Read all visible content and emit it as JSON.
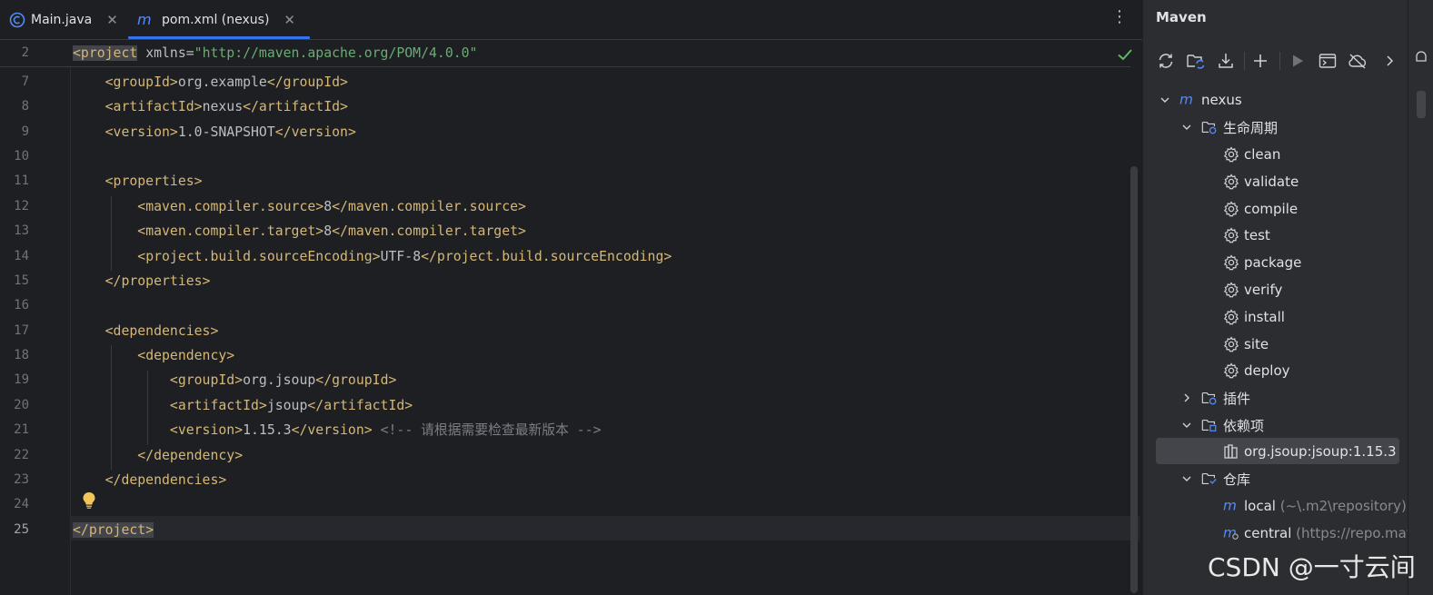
{
  "tabs": [
    {
      "label": "Main.java",
      "icon": "java-class-icon",
      "active": false
    },
    {
      "label": "pom.xml (nexus)",
      "icon": "maven-icon",
      "active": true
    }
  ],
  "editor": {
    "sticky_line": {
      "number": "2",
      "text": "<project xmlns=\"http://maven.apache.org/POM/4.0.0\""
    },
    "lines": [
      {
        "number": "7",
        "text": "    <groupId>org.example</groupId>"
      },
      {
        "number": "8",
        "text": "    <artifactId>nexus</artifactId>"
      },
      {
        "number": "9",
        "text": "    <version>1.0-SNAPSHOT</version>"
      },
      {
        "number": "10",
        "text": ""
      },
      {
        "number": "11",
        "text": "    <properties>"
      },
      {
        "number": "12",
        "text": "        <maven.compiler.source>8</maven.compiler.source>"
      },
      {
        "number": "13",
        "text": "        <maven.compiler.target>8</maven.compiler.target>"
      },
      {
        "number": "14",
        "text": "        <project.build.sourceEncoding>UTF-8</project.build.sourceEncoding>"
      },
      {
        "number": "15",
        "text": "    </properties>"
      },
      {
        "number": "16",
        "text": ""
      },
      {
        "number": "17",
        "text": "    <dependencies>"
      },
      {
        "number": "18",
        "text": "        <dependency>"
      },
      {
        "number": "19",
        "text": "            <groupId>org.jsoup</groupId>"
      },
      {
        "number": "20",
        "text": "            <artifactId>jsoup</artifactId>"
      },
      {
        "number": "21",
        "text": "            <version>1.15.3</version> <!-- 请根据需要检查最新版本 -->"
      },
      {
        "number": "22",
        "text": "        </dependency>"
      },
      {
        "number": "23",
        "text": "    </dependencies>"
      },
      {
        "number": "24",
        "text": ""
      },
      {
        "number": "25",
        "text": "</project>"
      }
    ],
    "current_line": "25"
  },
  "maven": {
    "title": "Maven",
    "toolbar": [
      "reload-icon",
      "reload-project-icon",
      "download-icon",
      "add-icon",
      "run-icon",
      "execute-goal-icon",
      "offline-icon",
      "more-icon"
    ],
    "project": "nexus",
    "lifecycle_label": "生命周期",
    "lifecycle_goals": [
      "clean",
      "validate",
      "compile",
      "test",
      "package",
      "verify",
      "install",
      "site",
      "deploy"
    ],
    "plugins_label": "插件",
    "dependencies_label": "依赖项",
    "dependency": "org.jsoup:jsoup:1.15.3",
    "repositories_label": "仓库",
    "repositories": [
      {
        "name": "local",
        "detail": "(~\\.m2\\repository)"
      },
      {
        "name": "central",
        "detail": "(https://repo.mav"
      }
    ]
  },
  "watermark": "CSDN @一寸云间",
  "colors": {
    "accent": "#3574f0",
    "tag": "#d5b778",
    "string": "#6aab73",
    "comment": "#7a7e85"
  }
}
